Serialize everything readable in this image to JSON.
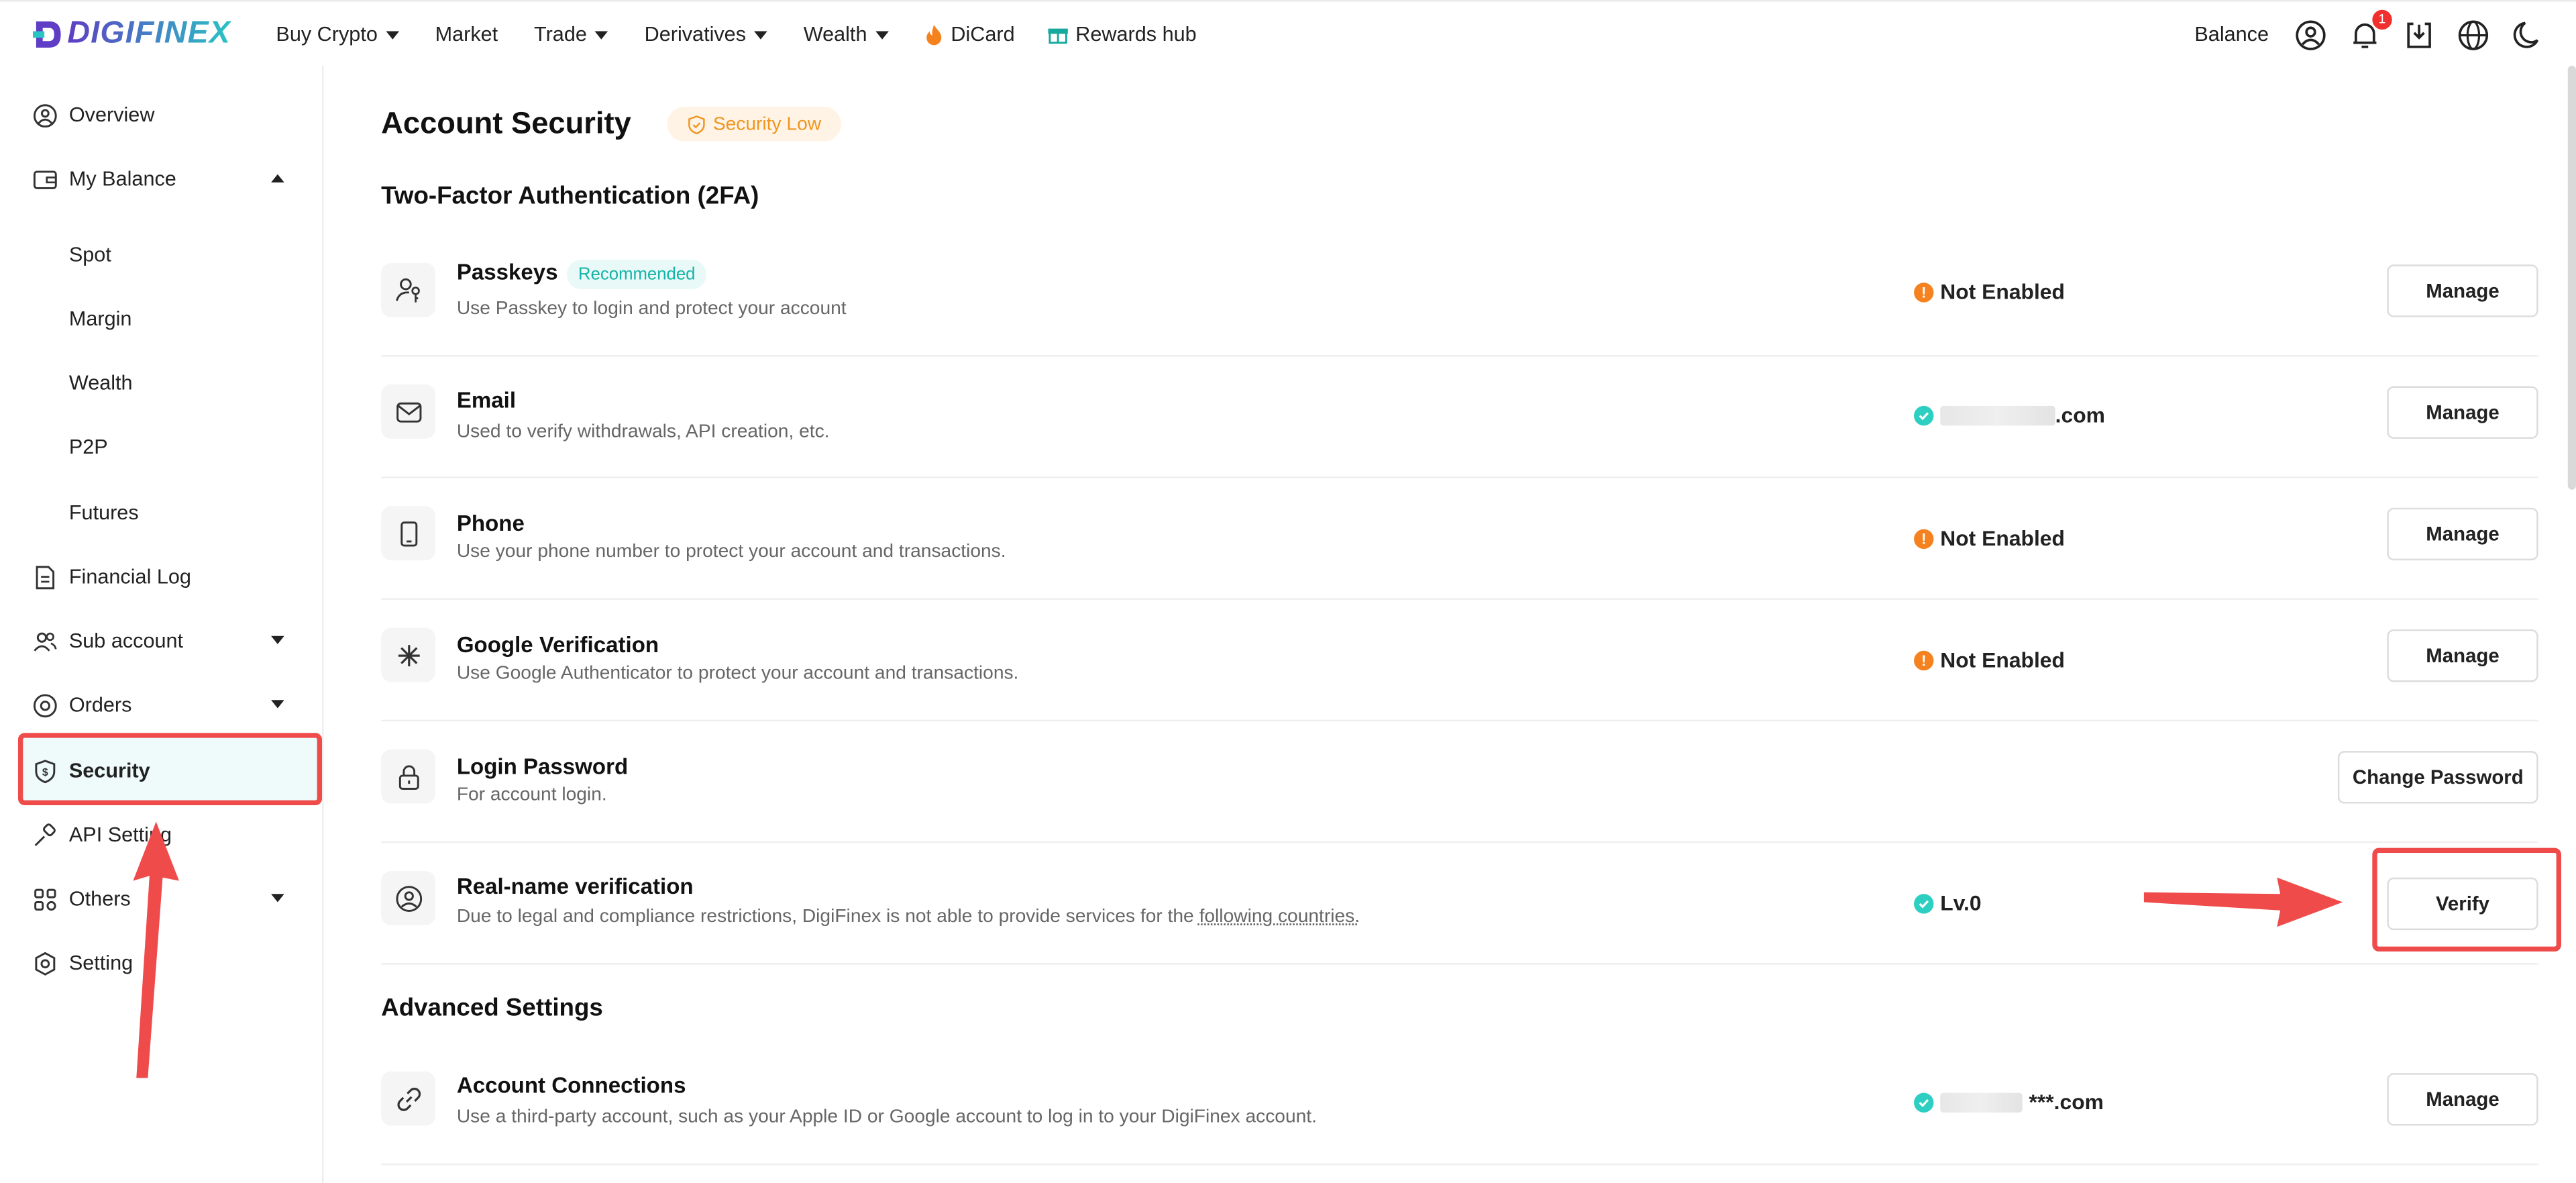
{
  "brand": {
    "name": "DIGIFINEX"
  },
  "nav": {
    "items": [
      {
        "label": "Buy Crypto",
        "dropdown": true
      },
      {
        "label": "Market",
        "dropdown": false
      },
      {
        "label": "Trade",
        "dropdown": true
      },
      {
        "label": "Derivatives",
        "dropdown": true
      },
      {
        "label": "Wealth",
        "dropdown": true
      },
      {
        "label": "DiCard",
        "icon": "fire-icon"
      },
      {
        "label": "Rewards hub",
        "icon": "gift-icon"
      }
    ],
    "right": {
      "balance_label": "Balance",
      "notification_count": "1"
    }
  },
  "sidebar": {
    "items": [
      {
        "label": "Overview",
        "icon": "user-circle-icon"
      },
      {
        "label": "My Balance",
        "icon": "wallet-icon",
        "expanded": true
      },
      {
        "label": "Spot"
      },
      {
        "label": "Margin"
      },
      {
        "label": "Wealth"
      },
      {
        "label": "P2P"
      },
      {
        "label": "Futures"
      },
      {
        "label": "Financial Log",
        "icon": "document-icon"
      },
      {
        "label": "Sub account",
        "icon": "users-icon",
        "expanded": false
      },
      {
        "label": "Orders",
        "icon": "orders-icon",
        "expanded": false
      },
      {
        "label": "Security",
        "icon": "shield-icon",
        "active": true
      },
      {
        "label": "API Setting",
        "icon": "api-icon"
      },
      {
        "label": "Others",
        "icon": "grid-icon",
        "expanded": false
      },
      {
        "label": "Setting",
        "icon": "gear-icon"
      }
    ]
  },
  "page": {
    "title": "Account Security",
    "security_badge": "Security Low",
    "section_2fa": "Two-Factor Authentication (2FA)",
    "section_advanced": "Advanced Settings"
  },
  "rows": [
    {
      "title": "Passkeys",
      "tag": "Recommended",
      "desc": "Use Passkey to login and protect your account",
      "status": "Not Enabled",
      "status_type": "warn",
      "action": "Manage",
      "icon": "passkey-icon"
    },
    {
      "title": "Email",
      "desc": "Used to verify withdrawals, API creation, etc.",
      "status": ".com",
      "status_type": "ok",
      "action": "Manage",
      "icon": "mail-icon"
    },
    {
      "title": "Phone",
      "desc": "Use your phone number to protect your account and transactions.",
      "status": "Not Enabled",
      "status_type": "warn",
      "action": "Manage",
      "icon": "phone-icon"
    },
    {
      "title": "Google Verification",
      "desc": "Use Google Authenticator to protect your account and transactions.",
      "status": "Not Enabled",
      "status_type": "warn",
      "action": "Manage",
      "icon": "asterisk-icon"
    },
    {
      "title": "Login Password",
      "desc": "For account login.",
      "action": "Change Password",
      "icon": "lock-icon"
    },
    {
      "title": "Real-name verification",
      "desc_prefix": "Due to legal and compliance restrictions, DigiFinex is not able to provide services for the ",
      "desc_link": "following countries.",
      "status": "Lv.0",
      "status_type": "ok",
      "action": "Verify",
      "icon": "id-icon"
    }
  ],
  "advanced_rows": [
    {
      "title": "Account Connections",
      "desc": "Use a third-party account, such as your Apple ID or Google account to log in to your DigiFinex account.",
      "status": "***.com",
      "status_type": "ok",
      "action": "Manage",
      "icon": "link-icon"
    }
  ],
  "colors": {
    "accent": "#2ccfc1",
    "warning": "#f5821f",
    "annotation": "#ef4b4b"
  }
}
